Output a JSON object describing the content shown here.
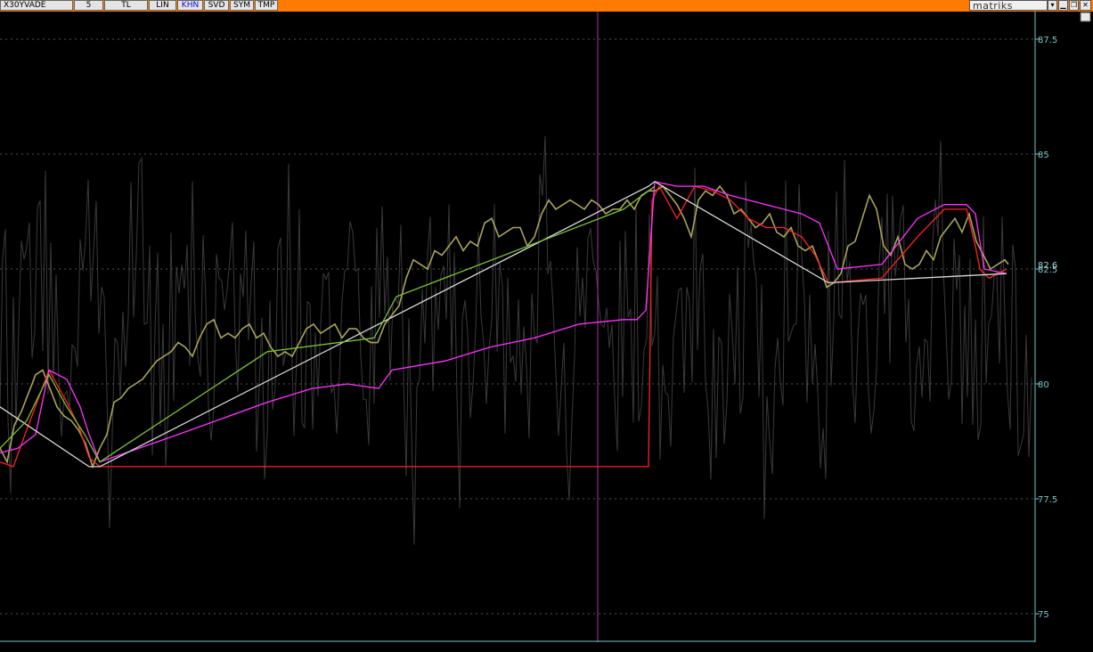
{
  "toolbar": {
    "symbol": "X30YVADE",
    "period": "5",
    "buttons": [
      "TL",
      "LIN",
      "KHN",
      "SVD",
      "SYM",
      "TMP"
    ],
    "active_button": "KHN"
  },
  "brand": {
    "name": "matriks"
  },
  "window_controls": {
    "menu": "▾",
    "minimize": "▁",
    "restore": "❐",
    "close": "✕"
  },
  "colors": {
    "toolbar_bg": "#ff7a00",
    "background": "#000000",
    "price_line": "#a8a45a",
    "moving_average_1": "#ff2222",
    "moving_average_2": "#ff33ff",
    "trend_line": "#d8d8d8",
    "signal_line": "#7cc23a",
    "axis": "#79c7cf"
  },
  "chart_data": {
    "type": "line",
    "title": "",
    "xlabel": "",
    "ylabel": "",
    "ylim": [
      74.4,
      88.1
    ],
    "y_ticks": [
      75,
      77.5,
      80,
      82.5,
      85,
      87.5
    ],
    "last_price": "82.6",
    "grid": true,
    "series": [
      {
        "color": "#a8a45a",
        "x": [
          0,
          8,
          16,
          24,
          32,
          40,
          48,
          56,
          64,
          72,
          80,
          88,
          96,
          104,
          112,
          120,
          128,
          136,
          144,
          152,
          160,
          168,
          176,
          184,
          192,
          200,
          208,
          216,
          224,
          232,
          240,
          248,
          256,
          264,
          272,
          280,
          288,
          296,
          304,
          312,
          320,
          328,
          336,
          344,
          352,
          360,
          368,
          376,
          384,
          392,
          400,
          408,
          416,
          424,
          432,
          440,
          448,
          456,
          464,
          472,
          480,
          488,
          496,
          504,
          512,
          520,
          528,
          536,
          544,
          552,
          560,
          568,
          576,
          584,
          592,
          600,
          608,
          616,
          624,
          632,
          640,
          648,
          656,
          664,
          672,
          680,
          688,
          696,
          704,
          712,
          720,
          728,
          736,
          744,
          752,
          760,
          768,
          776,
          784,
          792,
          800,
          808,
          816,
          824,
          832,
          840,
          848,
          856,
          864,
          872,
          880,
          888,
          896,
          904,
          912,
          920,
          928,
          936,
          944,
          952,
          960,
          968,
          976,
          984,
          992,
          1000,
          1008,
          1016,
          1024,
          1032,
          1040,
          1048,
          1056,
          1064,
          1072,
          1080,
          1088,
          1096,
          1104,
          1112,
          1120,
          1128,
          1132
        ],
        "values": [
          78.6,
          78.3,
          79.1,
          79.4,
          79.8,
          80.2,
          80.3,
          79.9,
          79.5,
          79.3,
          79.2,
          79.0,
          78.7,
          78.2,
          78.6,
          78.9,
          79.6,
          79.7,
          79.9,
          80.0,
          80.1,
          80.3,
          80.5,
          80.6,
          80.7,
          80.9,
          80.8,
          80.6,
          81.0,
          81.3,
          81.4,
          81.0,
          81.1,
          81.0,
          81.2,
          81.3,
          81.0,
          81.1,
          80.8,
          80.6,
          80.7,
          80.6,
          80.9,
          81.2,
          81.3,
          81.1,
          81.2,
          81.3,
          81.0,
          81.2,
          81.2,
          81.0,
          80.9,
          80.9,
          81.3,
          81.5,
          81.7,
          82.3,
          82.7,
          82.6,
          82.5,
          82.9,
          82.8,
          83.0,
          83.2,
          82.9,
          83.1,
          83.0,
          83.5,
          83.6,
          83.2,
          83.3,
          83.4,
          83.4,
          83.0,
          83.2,
          83.7,
          84.0,
          83.8,
          83.9,
          84.0,
          83.9,
          83.8,
          84.0,
          83.9,
          83.7,
          83.8,
          83.8,
          84.0,
          83.8,
          84.1,
          84.2,
          84.2,
          84.3,
          84.1,
          83.9,
          83.6,
          83.2,
          84.0,
          84.2,
          84.1,
          84.3,
          84.1,
          83.7,
          83.8,
          83.6,
          83.4,
          83.5,
          83.7,
          83.3,
          83.2,
          83.4,
          83.0,
          82.9,
          83.0,
          82.6,
          82.1,
          82.2,
          82.4,
          83.0,
          83.1,
          83.6,
          84.1,
          83.8,
          83.0,
          82.8,
          83.2,
          82.6,
          82.5,
          82.6,
          82.9,
          82.7,
          83.2,
          83.4,
          83.6,
          83.3,
          83.7,
          83.1,
          82.8,
          82.5,
          82.6,
          82.7,
          82.6
        ]
      },
      {
        "color": "#ff2222",
        "x": [
          0,
          15,
          30,
          55,
          75,
          88,
          100,
          112,
          300,
          600,
          700,
          728,
          732,
          740,
          760,
          780,
          800,
          820,
          840,
          860,
          880,
          900,
          915,
          930,
          990,
          1030,
          1060,
          1085,
          1095,
          1100,
          1110,
          1130
        ],
        "values": [
          78.3,
          78.2,
          79.0,
          80.3,
          79.6,
          79.1,
          78.4,
          78.2,
          78.2,
          78.2,
          78.2,
          78.2,
          84.0,
          84.3,
          83.6,
          84.3,
          84.2,
          84.0,
          83.6,
          83.4,
          83.4,
          83.2,
          82.8,
          82.2,
          82.3,
          83.2,
          83.8,
          83.8,
          83.0,
          82.5,
          82.3,
          82.5
        ]
      },
      {
        "color": "#ff33ff",
        "x": [
          0,
          20,
          40,
          55,
          75,
          90,
          100,
          112,
          200,
          300,
          350,
          390,
          425,
          440,
          500,
          550,
          600,
          650,
          700,
          715,
          725,
          735,
          760,
          790,
          820,
          860,
          900,
          920,
          940,
          990,
          1030,
          1060,
          1085,
          1095,
          1105,
          1130
        ],
        "values": [
          78.5,
          78.6,
          78.9,
          80.3,
          80.1,
          79.5,
          78.9,
          78.3,
          78.9,
          79.6,
          79.9,
          80.0,
          79.9,
          80.3,
          80.5,
          80.8,
          81.0,
          81.3,
          81.4,
          81.4,
          81.6,
          84.4,
          84.3,
          84.3,
          84.1,
          83.9,
          83.7,
          83.5,
          82.5,
          82.6,
          83.6,
          83.9,
          83.9,
          83.7,
          82.5,
          82.4
        ]
      },
      {
        "color": "#d8d8d8",
        "x": [
          0,
          100,
          112,
          728,
          735,
          930,
          1130
        ],
        "values": [
          79.5,
          78.2,
          78.2,
          84.3,
          84.4,
          82.2,
          82.4
        ]
      },
      {
        "color": "#7cc23a",
        "x": [
          0,
          30,
          55,
          75,
          95,
          112,
          300,
          420,
          445,
          700,
          728,
          735
        ],
        "values": [
          78.6,
          79.2,
          80.2,
          79.5,
          78.9,
          78.3,
          80.7,
          81.0,
          81.9,
          83.8,
          84.2,
          84.3
        ]
      }
    ]
  }
}
